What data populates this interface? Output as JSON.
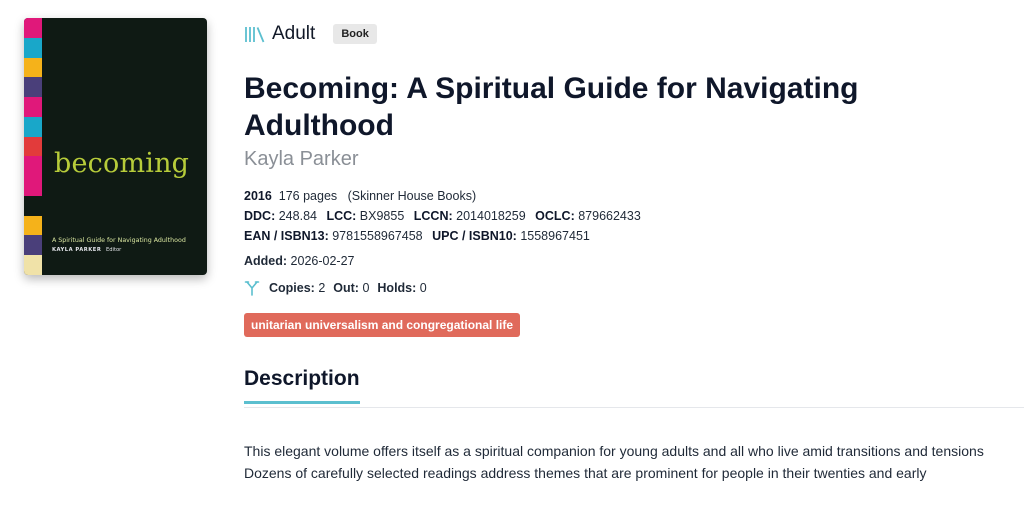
{
  "book": {
    "audience": "Adult",
    "format": "Book",
    "title": "Becoming: A Spiritual Guide for Navigating Adulthood",
    "author": "Kayla Parker",
    "year": "2016",
    "pages": "176 pages",
    "publisher": "(Skinner House Books)",
    "ddc_label": "DDC:",
    "ddc": "248.84",
    "lcc_label": "LCC:",
    "lcc": "BX9855",
    "lccn_label": "LCCN:",
    "lccn": "2014018259",
    "oclc_label": "OCLC:",
    "oclc": "879662433",
    "isbn13_label": "EAN / ISBN13:",
    "isbn13": "9781558967458",
    "isbn10_label": "UPC / ISBN10:",
    "isbn10": "1558967451",
    "added_label": "Added:",
    "added": "2026-02-27",
    "copies_label": "Copies:",
    "copies": "2",
    "out_label": "Out:",
    "out": "0",
    "holds_label": "Holds:",
    "holds": "0",
    "subject": "unitarian universalism and congregational life"
  },
  "cover": {
    "title": "becoming",
    "subtitle": "A Spiritual Guide for Navigating Adulthood",
    "author": "KAYLA PARKER",
    "editor": "Editor",
    "background": "#0f1a14",
    "title_color": "#b7cc3a",
    "stripe_colors": [
      "#e0187a",
      "#19a7c9",
      "#f5b21a",
      "#4a3f7a",
      "#e0187a",
      "#19a7c9",
      "#e23b3b",
      "#e0187a",
      "#e0187a",
      "#0f1a14",
      "#f5b21a",
      "#4a3f7a",
      "#f0e2a8"
    ]
  },
  "description": {
    "heading": "Description",
    "text": "This elegant volume offers itself as a spiritual companion for young adults and all who live amid transitions and tensions Dozens of carefully selected readings address themes that are prominent for people in their twenties and early"
  },
  "colors": {
    "accent": "#5bbfcf",
    "tag": "#e06a5b",
    "author_gray": "#8a8f96"
  },
  "icons": {
    "audience": "books-icon",
    "copies": "branch-icon"
  }
}
